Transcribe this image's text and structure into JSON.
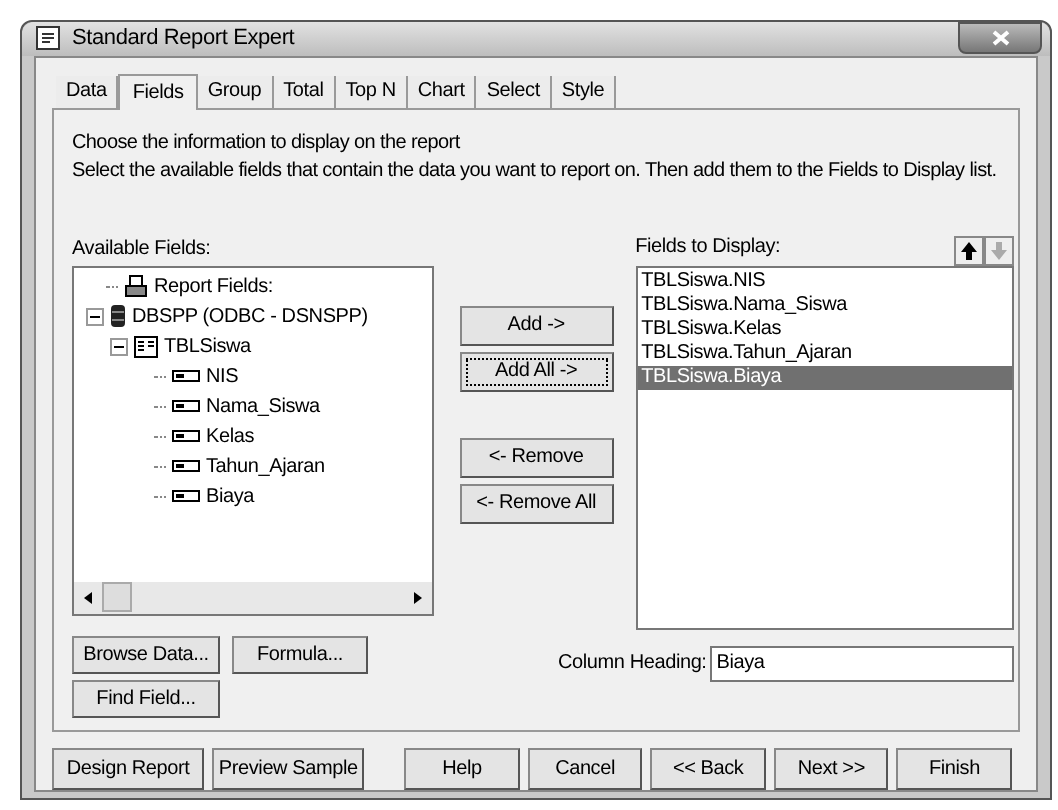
{
  "window": {
    "title": "Standard Report Expert"
  },
  "tabs": [
    {
      "label": "Data",
      "selected": false
    },
    {
      "label": "Fields",
      "selected": true
    },
    {
      "label": "Group",
      "selected": false
    },
    {
      "label": "Total",
      "selected": false
    },
    {
      "label": "Top N",
      "selected": false
    },
    {
      "label": "Chart",
      "selected": false
    },
    {
      "label": "Select",
      "selected": false
    },
    {
      "label": "Style",
      "selected": false
    }
  ],
  "instructions": [
    "Choose the information to display on the report",
    "Select the available fields that contain the data you want to report on.  Then add them to the Fields to Display list."
  ],
  "available_fields": {
    "label": "Available Fields:",
    "tree": [
      {
        "kind": "report",
        "label": "Report Fields:"
      },
      {
        "kind": "database",
        "label": "DBSPP (ODBC - DSNSPP)",
        "expanded": true,
        "children": [
          {
            "kind": "table",
            "label": "TBLSiswa",
            "expanded": true,
            "children": [
              {
                "kind": "field",
                "label": "NIS"
              },
              {
                "kind": "field",
                "label": "Nama_Siswa"
              },
              {
                "kind": "field",
                "label": "Kelas"
              },
              {
                "kind": "field",
                "label": "Tahun_Ajaran"
              },
              {
                "kind": "field",
                "label": "Biaya"
              }
            ]
          }
        ]
      }
    ]
  },
  "move_buttons": [
    {
      "label": "Add ->",
      "focused": false
    },
    {
      "label": "Add All ->",
      "focused": true
    },
    {
      "label": "<- Remove",
      "focused": false
    },
    {
      "label": "<- Remove All",
      "focused": false
    }
  ],
  "fields_to_display": {
    "label": "Fields to Display:",
    "items": [
      {
        "label": "TBLSiswa.NIS",
        "selected": false
      },
      {
        "label": "TBLSiswa.Nama_Siswa",
        "selected": false
      },
      {
        "label": "TBLSiswa.Kelas",
        "selected": false
      },
      {
        "label": "TBLSiswa.Tahun_Ajaran",
        "selected": false
      },
      {
        "label": "TBLSiswa.Biaya",
        "selected": true
      }
    ]
  },
  "field_buttons": [
    "Browse Data...",
    "Formula...",
    "Find Field..."
  ],
  "column_heading": {
    "label": "Column Heading:",
    "value": "Biaya"
  },
  "footer_buttons": [
    "Design Report",
    "Preview Sample",
    "Help",
    "Cancel",
    "<< Back",
    "Next >>",
    "Finish"
  ]
}
